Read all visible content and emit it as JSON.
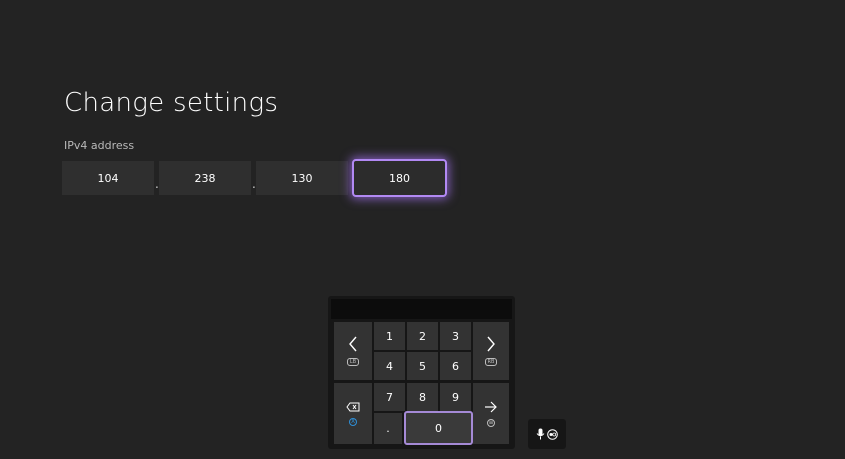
{
  "page": {
    "title": "Change settings",
    "field_label": "IPv4 address",
    "separator": "."
  },
  "ipv4": {
    "octets": [
      "104",
      "238",
      "130",
      "180"
    ],
    "focused_index": 3
  },
  "keypad": {
    "keys": {
      "k1": "1",
      "k2": "2",
      "k3": "3",
      "k4": "4",
      "k5": "5",
      "k6": "6",
      "k7": "7",
      "k8": "8",
      "k9": "9",
      "dot": ".",
      "k0": "0"
    },
    "hints": {
      "left": "LB",
      "right": "RB",
      "backspace": "X",
      "enter": "≡"
    }
  },
  "icons": {
    "left": "chevron-left-icon",
    "right": "chevron-right-icon",
    "backspace": "backspace-icon",
    "enter": "arrow-right-icon",
    "mic": "microphone-icon",
    "controller": "controller-button-icon"
  },
  "colors": {
    "background": "#232323",
    "focus_accent": "#b289f4",
    "key": "#333333",
    "x_button": "#2e8fd8"
  }
}
